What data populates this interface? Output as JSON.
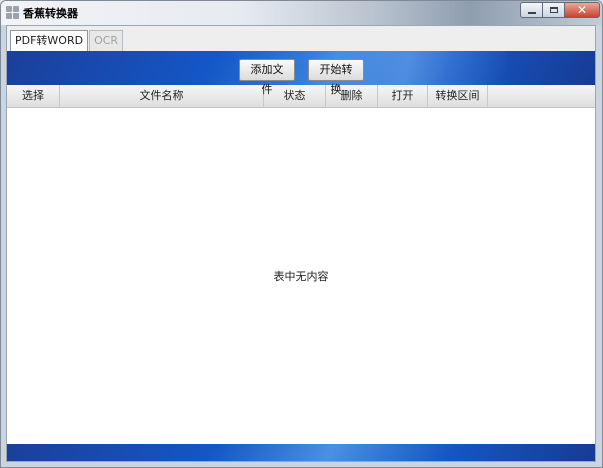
{
  "window": {
    "title": "香蕉转换器",
    "close_glyph": "✕"
  },
  "tabs": [
    {
      "label": "PDF转WORD",
      "active": true
    },
    {
      "label": "OCR",
      "active": false
    }
  ],
  "toolbar": {
    "add_file_label": "添加文件",
    "start_convert_label": "开始转换"
  },
  "table": {
    "columns": [
      "选择",
      "文件名称",
      "状态",
      "删除",
      "打开",
      "转换区间"
    ],
    "empty_message": "表中无内容"
  },
  "colors": {
    "banner_blue": "#1457c6",
    "close_red": "#c7432f"
  }
}
